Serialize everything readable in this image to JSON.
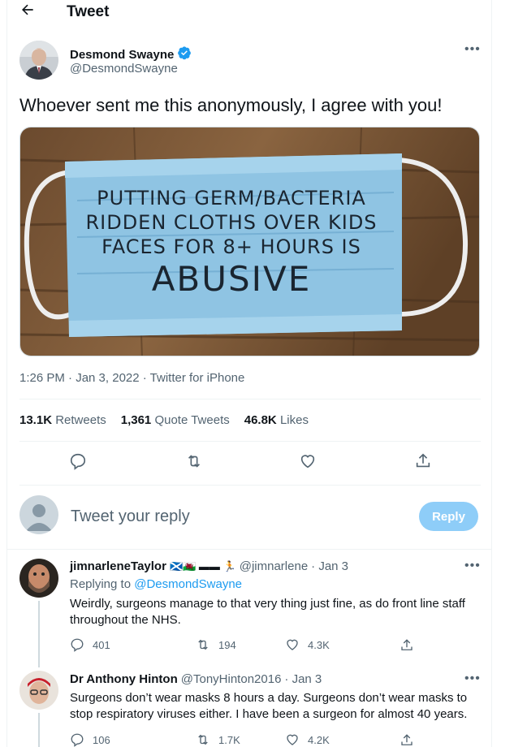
{
  "header": {
    "back_icon": "arrow-left-icon",
    "title": "Tweet"
  },
  "tweet": {
    "author_name": "Desmond Swayne",
    "author_handle": "@DesmondSwayne",
    "verified": true,
    "text": "Whoever sent me this anonymously, I agree with you!",
    "media_text": [
      "PUTTING GERM/BACTERIA",
      "RIDDEN CLOTHS OVER KIDS",
      "FACES FOR 8+ HOURS IS",
      "ABUSIVE"
    ],
    "meta": "1:26 PM · Jan 3, 2022 · Twitter for iPhone",
    "stats": {
      "retweets_count": "13.1K",
      "retweets_label": "Retweets",
      "quotes_count": "1,361",
      "quotes_label": "Quote Tweets",
      "likes_count": "46.8K",
      "likes_label": "Likes"
    }
  },
  "reply_box": {
    "placeholder": "Tweet your reply",
    "button_label": "Reply"
  },
  "replies": [
    {
      "name": "jimnarleneTaylor",
      "flags": "🏴󠁧󠁢󠁳󠁣󠁴󠁿🏴󠁧󠁢󠁷󠁬󠁳󠁿 ▬▬ 🏃",
      "handle": "@jimnarlene",
      "date": "· Jan 3",
      "replying_prefix": "Replying to",
      "replying_to": "@DesmondSwayne",
      "text": "Weirdly, surgeons manage to that very thing just fine, as do front line staff throughout the NHS.",
      "replies": "401",
      "retweets": "194",
      "likes": "4.3K"
    },
    {
      "name": "Dr Anthony Hinton",
      "handle": "@TonyHinton2016",
      "date": "· Jan 3",
      "text": "Surgeons  don’t wear masks 8 hours a day. Surgeons don’t wear masks to stop respiratory viruses either. I have been a surgeon for almost 40 years.",
      "replies": "106",
      "retweets": "1.7K",
      "likes": "4.2K"
    }
  ],
  "colors": {
    "accent": "#1d9bf0",
    "muted": "#536471",
    "reply_button": "#8ecdf8"
  }
}
